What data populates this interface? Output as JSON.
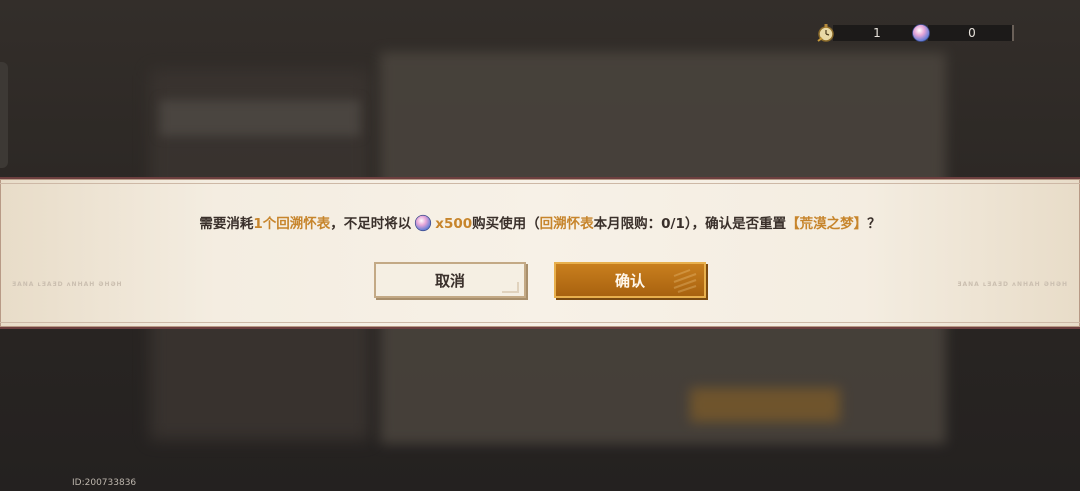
{
  "currencies": [
    {
      "icon": "pocket-watch-icon",
      "value": "1"
    },
    {
      "icon": "crystal-orb-icon",
      "value": "0"
    }
  ],
  "dialog": {
    "message": {
      "p1": "需要消耗",
      "item_count": "1个回溯怀表",
      "p2": "，不足时将以",
      "cost": "x500",
      "p3": "购买使用（",
      "item_name": "回溯怀表",
      "p4": "本月限购：0/1），确认是否重置",
      "target": "【荒漠之梦】",
      "p5": "？"
    },
    "cancel_label": "取消",
    "confirm_label": "确认",
    "watermark_left": "ƎANA ʟƎAƎD ʌNHAH ƏHƏH",
    "watermark_right": "ƎANA ʟƎAƎD ʌNHAH ƏHƏH"
  },
  "user_id": "ID:200733836",
  "colors": {
    "highlight": "#c7852c",
    "confirm": "#b56d16",
    "border": "#6d3f3f"
  }
}
